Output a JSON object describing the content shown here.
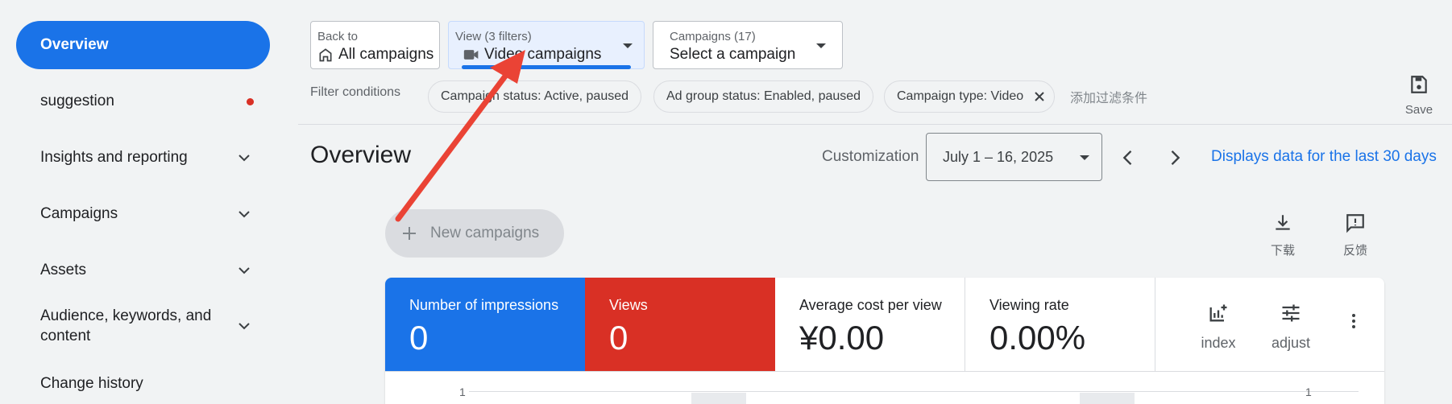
{
  "sidebar": {
    "overview": "Overview",
    "items": [
      {
        "label": "suggestion"
      },
      {
        "label": "Insights and reporting"
      },
      {
        "label": "Campaigns"
      },
      {
        "label": "Assets"
      },
      {
        "label": "Audience, keywords, and content"
      },
      {
        "label": "Change history"
      }
    ]
  },
  "back": {
    "small": "Back to",
    "big": "All campaigns"
  },
  "view": {
    "small": "View (3 filters)",
    "big": "Video campaigns"
  },
  "campaigns": {
    "small": "Campaigns (17)",
    "big": "Select a campaign"
  },
  "filters": {
    "label": "Filter conditions",
    "chips": [
      "Campaign status: Active, paused",
      "Ad group status: Enabled, paused",
      "Campaign type: Video"
    ],
    "add": "添加过滤条件"
  },
  "save_label": "Save",
  "header": {
    "title": "Overview",
    "customization": "Customization",
    "date_range": "July 1 – 16, 2025",
    "last30": "Displays data for the last 30 days"
  },
  "new_campaigns": "New campaigns",
  "tools": {
    "download": "下载",
    "feedback": "反馈"
  },
  "metrics": [
    {
      "label": "Number of impressions",
      "value": "0"
    },
    {
      "label": "Views",
      "value": "0"
    },
    {
      "label": "Average cost per view",
      "value": "¥0.00"
    },
    {
      "label": "Viewing rate",
      "value": "0.00%"
    }
  ],
  "card_tools": {
    "index": "index",
    "adjust": "adjust"
  },
  "chart_ticks": {
    "left": "1",
    "right": "1"
  },
  "colors": {
    "accent": "#1a73e8",
    "red": "#d93025",
    "annotation": "#ea4335"
  }
}
